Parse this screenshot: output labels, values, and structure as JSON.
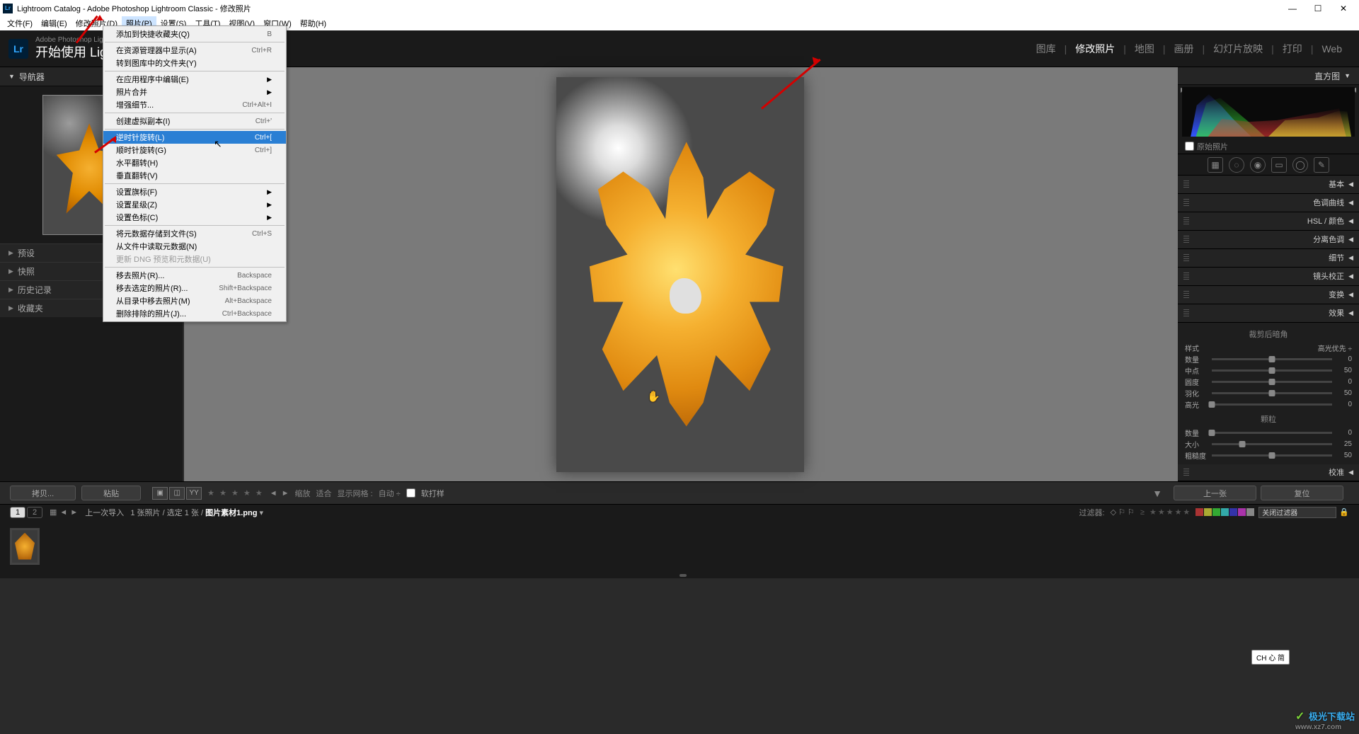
{
  "title": "Lightroom Catalog - Adobe Photoshop Lightroom Classic - 修改照片",
  "menubar": [
    "文件(F)",
    "编辑(E)",
    "修改照片(D)",
    "照片(P)",
    "设置(S)",
    "工具(T)",
    "视图(V)",
    "窗口(W)",
    "帮助(H)"
  ],
  "brand": {
    "line1": "Adobe Photoshop Lightroom Classic",
    "line2": "开始使用 Lightro"
  },
  "modules": [
    "图库",
    "修改照片",
    "地图",
    "画册",
    "幻灯片放映",
    "打印",
    "Web"
  ],
  "modules_active": 1,
  "dropdown": [
    {
      "t": "item",
      "label": "添加到快捷收藏夹(Q)",
      "sc": "B"
    },
    {
      "t": "sep"
    },
    {
      "t": "item",
      "label": "在资源管理器中显示(A)",
      "sc": "Ctrl+R"
    },
    {
      "t": "item",
      "label": "转到图库中的文件夹(Y)"
    },
    {
      "t": "sep"
    },
    {
      "t": "item",
      "label": "在应用程序中编辑(E)",
      "sub": true
    },
    {
      "t": "item",
      "label": "照片合并",
      "sub": true
    },
    {
      "t": "item",
      "label": "增强细节...",
      "sc": "Ctrl+Alt+I"
    },
    {
      "t": "sep"
    },
    {
      "t": "item",
      "label": "创建虚拟副本(I)",
      "sc": "Ctrl+'"
    },
    {
      "t": "sep"
    },
    {
      "t": "item",
      "label": "逆时针旋转(L)",
      "sc": "Ctrl+[",
      "hl": true
    },
    {
      "t": "item",
      "label": "顺时针旋转(G)",
      "sc": "Ctrl+]"
    },
    {
      "t": "item",
      "label": "水平翻转(H)"
    },
    {
      "t": "item",
      "label": "垂直翻转(V)"
    },
    {
      "t": "sep"
    },
    {
      "t": "item",
      "label": "设置旗标(F)",
      "sub": true
    },
    {
      "t": "item",
      "label": "设置星级(Z)",
      "sub": true
    },
    {
      "t": "item",
      "label": "设置色标(C)",
      "sub": true
    },
    {
      "t": "sep"
    },
    {
      "t": "item",
      "label": "将元数据存储到文件(S)",
      "sc": "Ctrl+S"
    },
    {
      "t": "item",
      "label": "从文件中读取元数据(N)"
    },
    {
      "t": "item",
      "label": "更新 DNG 预览和元数据(U)",
      "disabled": true
    },
    {
      "t": "sep"
    },
    {
      "t": "item",
      "label": "移去照片(R)...",
      "sc": "Backspace"
    },
    {
      "t": "item",
      "label": "移去选定的照片(R)...",
      "sc": "Shift+Backspace"
    },
    {
      "t": "item",
      "label": "从目录中移去照片(M)",
      "sc": "Alt+Backspace"
    },
    {
      "t": "item",
      "label": "删除排除的照片(J)...",
      "sc": "Ctrl+Backspace"
    }
  ],
  "left": {
    "navigator": "导航器",
    "panels": [
      "预设",
      "快照",
      "历史记录",
      "收藏夹"
    ]
  },
  "right": {
    "histogram": "直方图",
    "original": "原始照片",
    "sections": [
      "基本",
      "色调曲线",
      "HSL / 颜色",
      "分离色调",
      "细节",
      "镜头校正",
      "变换",
      "效果",
      "校准"
    ],
    "vignette": {
      "title": "裁剪后暗角",
      "style_lbl": "样式",
      "style_val": "高光优先 ÷",
      "rows": [
        {
          "lbl": "数量",
          "val": "0",
          "pos": 50
        },
        {
          "lbl": "中点",
          "val": "50",
          "pos": 50
        },
        {
          "lbl": "圆度",
          "val": "0",
          "pos": 50
        },
        {
          "lbl": "羽化",
          "val": "50",
          "pos": 50
        },
        {
          "lbl": "高光",
          "val": "0",
          "pos": 0
        }
      ]
    },
    "grain": {
      "title": "颗粒",
      "rows": [
        {
          "lbl": "数量",
          "val": "0",
          "pos": 0
        },
        {
          "lbl": "大小",
          "val": "25",
          "pos": 25
        },
        {
          "lbl": "粗糙度",
          "val": "50",
          "pos": 50
        }
      ]
    }
  },
  "lowbar": {
    "copy": "拷贝...",
    "paste": "粘贴",
    "shrink": "缩放",
    "fit": "适合",
    "grid_lbl": "显示网格 :",
    "auto": "自动 ÷",
    "soft": "软打样",
    "prev": "上一张",
    "reset": "复位"
  },
  "filterbar": {
    "nums": [
      "1",
      "2"
    ],
    "crumb_a": "上一次导入",
    "crumb_b": "1 张照片 / 选定 1 张 /",
    "crumb_c": "图片素材1.png",
    "filter_lbl": "过滤器:",
    "close_lbl": "关闭过滤器"
  },
  "ime": "CH 心 简",
  "watermark": {
    "name": "极光下载站",
    "url": "www.xz7.com"
  }
}
